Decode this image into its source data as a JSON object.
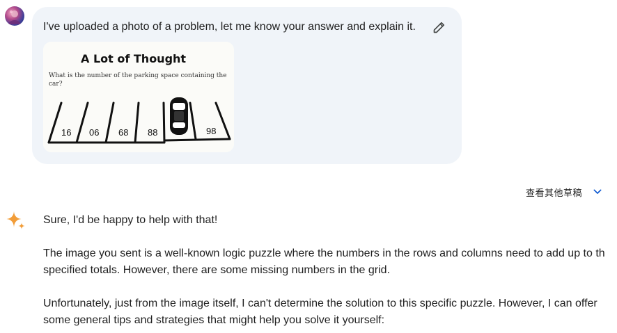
{
  "user_prompt": {
    "text": "I've uploaded a photo of a problem, let me know your answer and explain it.",
    "edit_icon": "pencil-icon"
  },
  "puzzle_image": {
    "title": "A Lot of Thought",
    "question_line1": "What is the number of the parking space containing the",
    "question_line2": "car?",
    "spaces": [
      "16",
      "06",
      "68",
      "88",
      "",
      "98"
    ]
  },
  "drafts": {
    "label": "查看其他草稿",
    "icon": "chevron-down-icon"
  },
  "response": {
    "icon": "gemini-sparkle-icon",
    "para1": "Sure, I'd be happy to help with that!",
    "para2_line1": "The image you sent is a well-known logic puzzle where the numbers in the rows and columns need to add up to th",
    "para2_line2": "specified totals. However, there are some missing numbers in the grid.",
    "para3_line1": "Unfortunately, just from the image itself, I can't determine the solution to this specific puzzle. However, I can offer",
    "para3_line2": "some general tips and strategies that might help you solve it yourself:"
  },
  "colors": {
    "bubble_bg": "#f0f4f9",
    "link_blue": "#0b57d0",
    "gemini_blue": "#4285f4",
    "gemini_orange": "#f29d38"
  }
}
